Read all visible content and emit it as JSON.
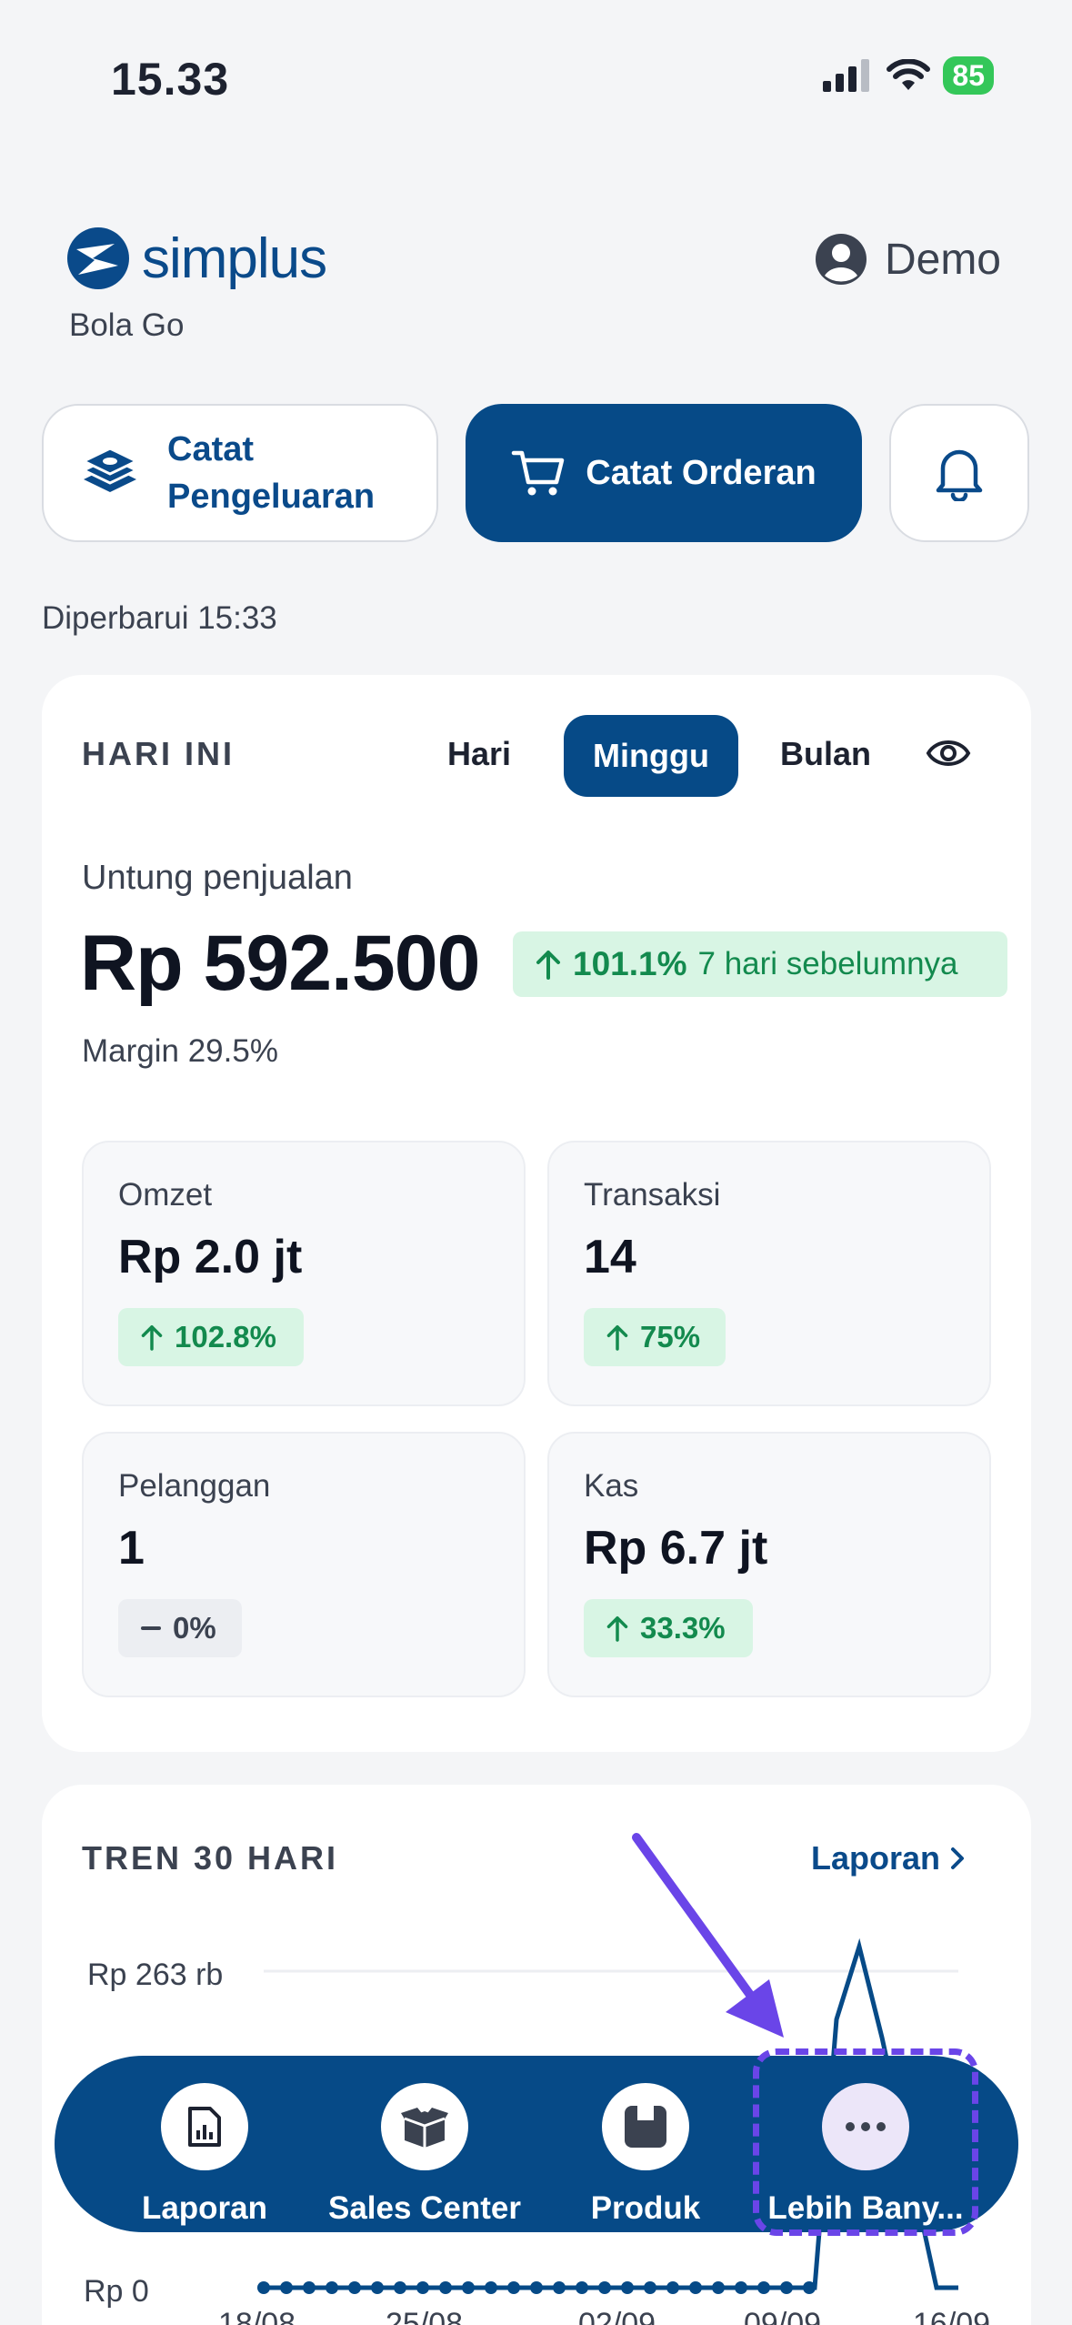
{
  "status_bar": {
    "time": "15.33",
    "battery": "85"
  },
  "header": {
    "brand": "simplus",
    "store": "Bola Go",
    "user": "Demo"
  },
  "actions": {
    "expense_line1": "Catat",
    "expense_line2": "Pengeluaran",
    "order": "Catat Orderan"
  },
  "updated": "Diperbarui 15:33",
  "summary": {
    "title": "HARI INI",
    "segments": [
      "Hari",
      "Minggu",
      "Bulan"
    ],
    "selected_segment": "Minggu",
    "profit_label": "Untung penjualan",
    "profit_value": "Rp 592.500",
    "profit_change": "101.1%",
    "profit_compare": "7 hari sebelumnya",
    "margin": "Margin 29.5%",
    "tiles": [
      {
        "label": "Omzet",
        "value": "Rp 2.0 jt",
        "change": "102.8%",
        "trend": "up"
      },
      {
        "label": "Transaksi",
        "value": "14",
        "change": "75%",
        "trend": "up"
      },
      {
        "label": "Pelanggan",
        "value": "1",
        "change": "0%",
        "trend": "flat"
      },
      {
        "label": "Kas",
        "value": "Rp 6.7 jt",
        "change": "33.3%",
        "trend": "up"
      }
    ]
  },
  "trend": {
    "title": "TREN 30 HARI",
    "link": "Laporan",
    "y_top": "Rp 263 rb",
    "y_bottom": "Rp 0",
    "x_labels": [
      "18/08",
      "25/08",
      "02/09",
      "09/09",
      "16/09"
    ]
  },
  "nav": {
    "items": [
      {
        "label": "Laporan",
        "icon": "report-icon"
      },
      {
        "label": "Sales Center",
        "icon": "box-icon"
      },
      {
        "label": "Produk",
        "icon": "product-icon"
      },
      {
        "label": "Lebih Bany...",
        "icon": "more-icon"
      }
    ]
  },
  "colors": {
    "primary": "#064a87",
    "positive": "#138a4e",
    "positive_bg": "#d8f5e4",
    "annotation": "#6a45e8"
  }
}
